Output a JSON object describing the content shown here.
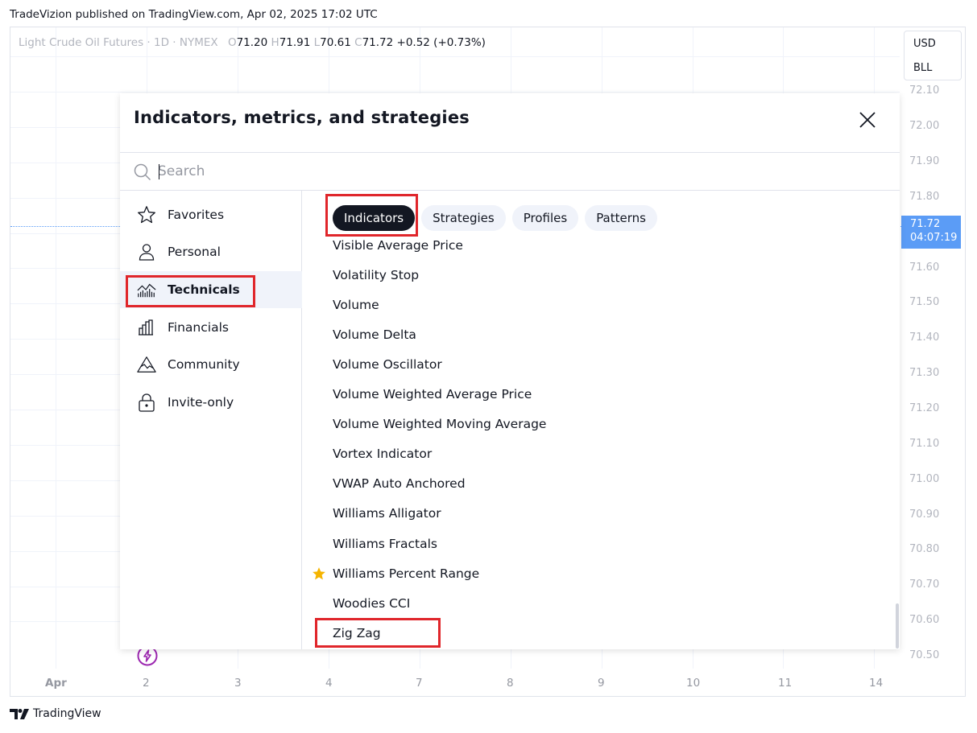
{
  "publish_line": "TradeVizion published on TradingView.com, Apr 02, 2025 17:02 UTC",
  "legend": {
    "symbol": "Light Crude Oil Futures · 1D · NYMEX",
    "o_key": "O",
    "o_val": "71.20",
    "h_key": "H",
    "h_val": "71.91",
    "l_key": "L",
    "l_val": "70.61",
    "c_key": "C",
    "c_val": "71.72",
    "change": "+0.52 (+0.73%)"
  },
  "currency": {
    "unit": "USD",
    "measure": "BLL"
  },
  "price_axis": [
    "72.10",
    "72.00",
    "71.90",
    "71.80",
    "71.60",
    "71.50",
    "71.40",
    "71.30",
    "71.20",
    "71.10",
    "71.00",
    "70.90",
    "70.80",
    "70.70",
    "70.60",
    "70.50"
  ],
  "current_price": {
    "price": "71.72",
    "countdown": "04:07:19"
  },
  "date_axis": [
    "Apr",
    "2",
    "3",
    "4",
    "7",
    "8",
    "9",
    "10",
    "11",
    "14"
  ],
  "footer_brand": "TradingView",
  "dialog": {
    "title": "Indicators, metrics, and strategies",
    "search_placeholder": "Search",
    "sidebar": [
      {
        "label": "Favorites",
        "icon": "star-outline-icon"
      },
      {
        "label": "Personal",
        "icon": "user-icon"
      },
      {
        "label": "Technicals",
        "icon": "technicals-chart-icon",
        "active": true
      },
      {
        "label": "Financials",
        "icon": "bar-chart-icon"
      },
      {
        "label": "Community",
        "icon": "community-mountain-icon"
      },
      {
        "label": "Invite-only",
        "icon": "lock-icon"
      }
    ],
    "tabs": [
      {
        "label": "Indicators",
        "active": true
      },
      {
        "label": "Strategies"
      },
      {
        "label": "Profiles"
      },
      {
        "label": "Patterns"
      }
    ],
    "items": [
      {
        "name": "Visible Average Price"
      },
      {
        "name": "Volatility Stop"
      },
      {
        "name": "Volume"
      },
      {
        "name": "Volume Delta"
      },
      {
        "name": "Volume Oscillator"
      },
      {
        "name": "Volume Weighted Average Price"
      },
      {
        "name": "Volume Weighted Moving Average"
      },
      {
        "name": "Vortex Indicator"
      },
      {
        "name": "VWAP Auto Anchored"
      },
      {
        "name": "Williams Alligator"
      },
      {
        "name": "Williams Fractals"
      },
      {
        "name": "Williams Percent Range",
        "favorite": true
      },
      {
        "name": "Woodies CCI"
      },
      {
        "name": "Zig Zag"
      }
    ]
  },
  "colors": {
    "accent_blue": "#5b9cf6",
    "highlight_red": "#e0262b",
    "favorite_star": "#f5b400",
    "bolt_purple": "#9c27b0"
  }
}
